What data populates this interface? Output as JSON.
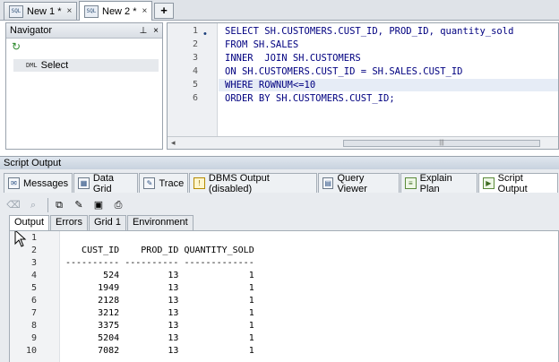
{
  "doc_tabs": [
    {
      "label": "New 1 *",
      "icon": "sql-file-icon"
    },
    {
      "label": "New 2 *",
      "icon": "sql-file-icon"
    }
  ],
  "doc_tab_icon_text": "SQL",
  "new_tab_symbol": "+",
  "navigator": {
    "title": "Navigator",
    "pin_glyph": "⊥",
    "close_glyph": "×",
    "refresh_glyph": "↻",
    "item_prefix": "DML",
    "item_label": "Select"
  },
  "editor": {
    "line_numbers": [
      "1",
      "2",
      "3",
      "4",
      "5",
      "6"
    ],
    "lines": [
      "SELECT SH.CUSTOMERS.CUST_ID, PROD_ID, quantity_sold",
      "FROM SH.SALES",
      "INNER  JOIN SH.CUSTOMERS",
      "ON SH.CUSTOMERS.CUST_ID = SH.SALES.CUST_ID",
      "WHERE ROWNUM<=10",
      "ORDER BY SH.CUSTOMERS.CUST_ID;"
    ],
    "scroll_left_glyph": "◂",
    "thumb_grip": "|||"
  },
  "script_output": {
    "panel_title": "Script Output",
    "tabs": [
      {
        "label": "Messages",
        "icon": "messages-icon"
      },
      {
        "label": "Data Grid",
        "icon": "data-grid-icon"
      },
      {
        "label": "Trace",
        "icon": "trace-icon"
      },
      {
        "label": "DBMS Output (disabled)",
        "icon": "dbms-output-icon"
      },
      {
        "label": "Query Viewer",
        "icon": "query-viewer-icon"
      },
      {
        "label": "Explain Plan",
        "icon": "explain-plan-icon"
      },
      {
        "label": "Script Output",
        "icon": "script-output-icon"
      }
    ],
    "sub_tabs": [
      "Output",
      "Errors",
      "Grid 1",
      "Environment"
    ],
    "output_line_numbers": [
      "1",
      "2",
      "3",
      "4",
      "5",
      "6",
      "7",
      "8",
      "9",
      "10"
    ],
    "output_lines": [
      "",
      "   CUST_ID    PROD_ID QUANTITY_SOLD",
      "---------- ---------- -------------",
      "       524         13             1",
      "      1949         13             1",
      "      2128         13             1",
      "      3212         13             1",
      "      3375         13             1",
      "      5204         13             1",
      "      7082         13             1"
    ]
  }
}
